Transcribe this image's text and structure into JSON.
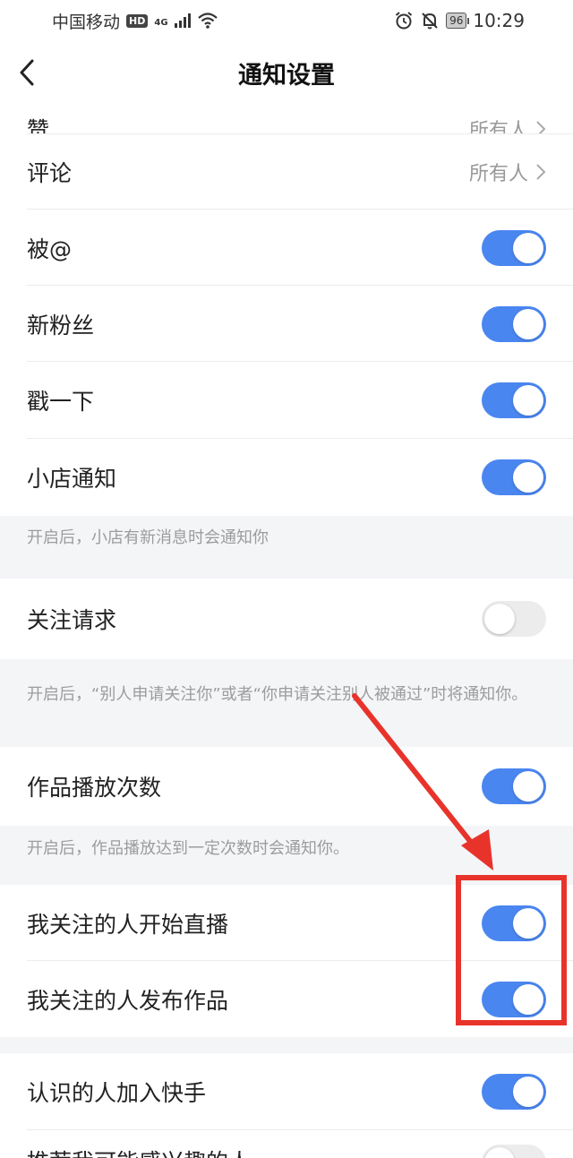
{
  "status_bar": {
    "carrier": "中国移动",
    "hd": "HD",
    "network": "4G",
    "battery": "96",
    "time": "10:29"
  },
  "nav": {
    "title": "通知设置"
  },
  "rows": {
    "partial_top": {
      "label": "赞",
      "value": "所有人"
    },
    "comment": {
      "label": "评论",
      "value": "所有人"
    },
    "mention": {
      "label": "被@",
      "on": true
    },
    "new_fans": {
      "label": "新粉丝",
      "on": true
    },
    "poke": {
      "label": "戳一下",
      "on": true
    },
    "shop": {
      "label": "小店通知",
      "on": true
    },
    "follow_request": {
      "label": "关注请求",
      "on": false
    },
    "play_count": {
      "label": "作品播放次数",
      "on": true
    },
    "live_start": {
      "label": "我关注的人开始直播",
      "on": true
    },
    "new_work": {
      "label": "我关注的人发布作品",
      "on": true
    },
    "friend_join": {
      "label": "认识的人加入快手",
      "on": true
    },
    "recommend": {
      "label": "推荐我可能感兴趣的人",
      "on": false
    }
  },
  "notes": {
    "shop": "开启后，小店有新消息时会通知你",
    "follow_request": "开启后，“别人申请关注你”或者“你申请关注别人被通过”时将通知你。",
    "play_count": "开启后，作品播放达到一定次数时会通知你。"
  },
  "colors": {
    "toggle_on": "#4a86f0",
    "toggle_off": "#ececec",
    "annotation": "#e8332b"
  }
}
